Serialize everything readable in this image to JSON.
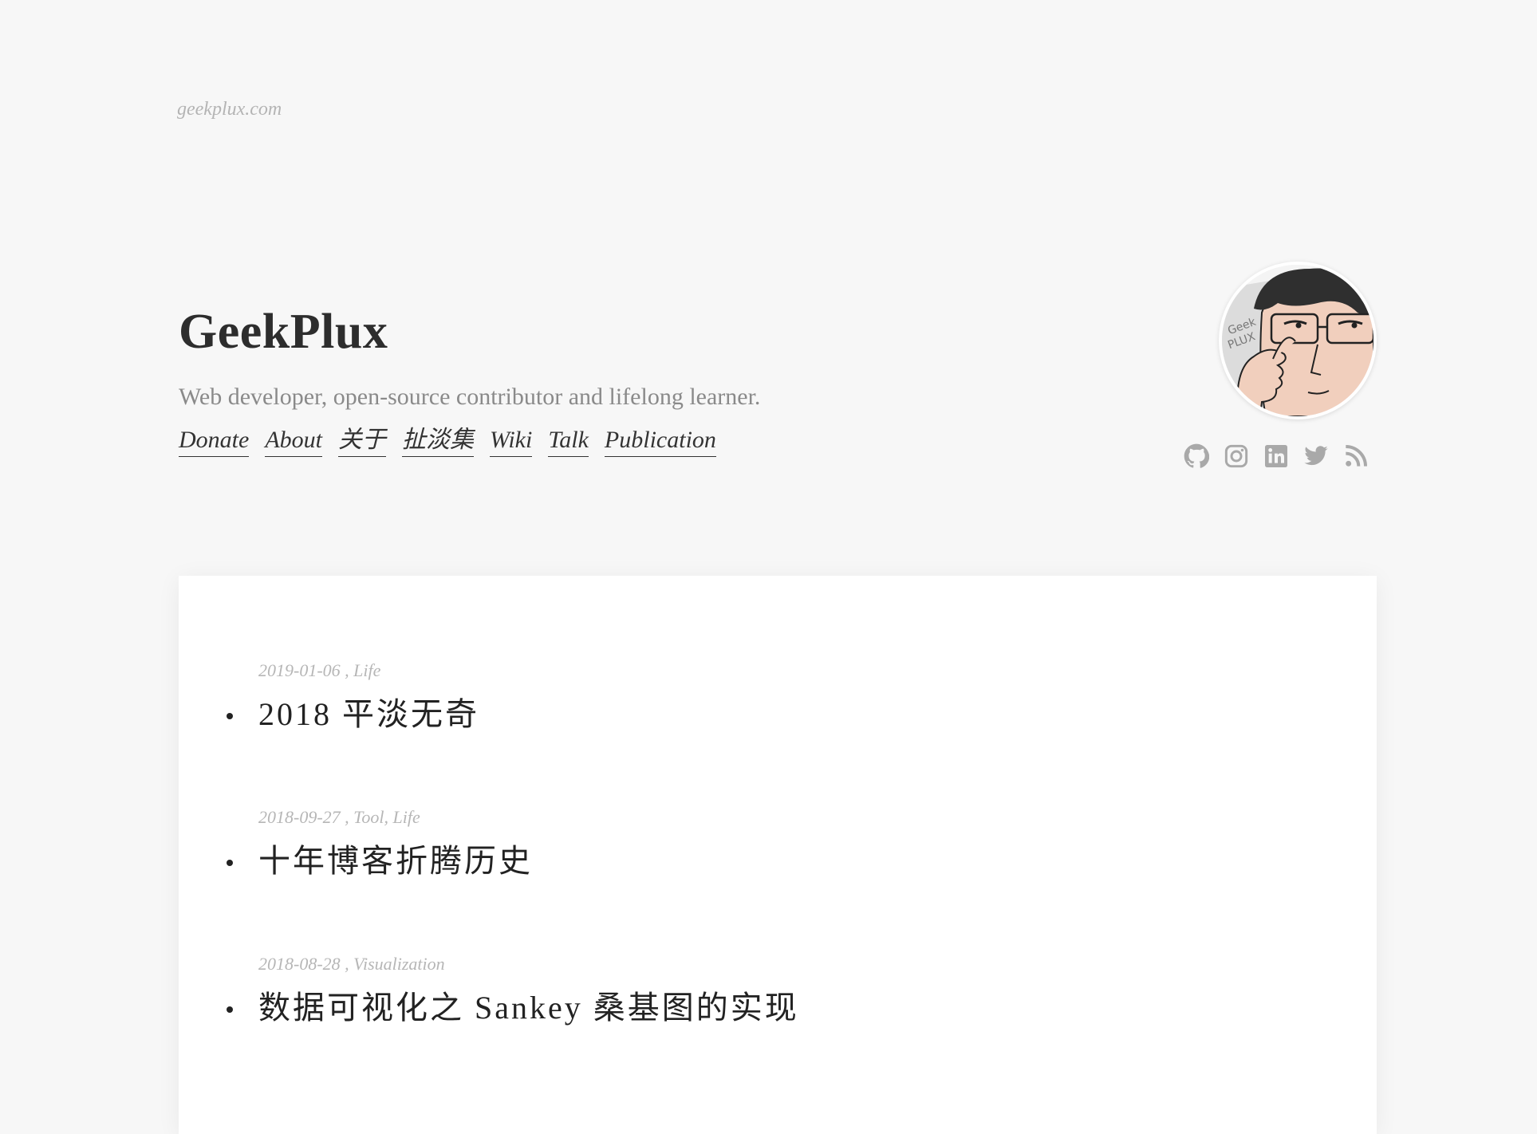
{
  "site": {
    "url": "geekplux.com",
    "title": "GeekPlux",
    "tagline": "Web developer, open-source contributor and lifelong learner."
  },
  "nav": [
    {
      "label": "Donate"
    },
    {
      "label": "About"
    },
    {
      "label": "关于"
    },
    {
      "label": "扯淡集"
    },
    {
      "label": "Wiki"
    },
    {
      "label": "Talk"
    },
    {
      "label": "Publication"
    }
  ],
  "social": [
    {
      "icon": "github-icon"
    },
    {
      "icon": "instagram-icon"
    },
    {
      "icon": "linkedin-icon"
    },
    {
      "icon": "twitter-icon"
    },
    {
      "icon": "rss-icon"
    }
  ],
  "posts": [
    {
      "date": "2019-01-06",
      "categories": "Life",
      "meta": "2019-01-06 , Life",
      "title": "2018 平淡无奇"
    },
    {
      "date": "2018-09-27",
      "categories": "Tool, Life",
      "meta": "2018-09-27 , Tool, Life",
      "title": "十年博客折腾历史"
    },
    {
      "date": "2018-08-28",
      "categories": "Visualization",
      "meta": "2018-08-28 , Visualization",
      "title": "数据可视化之 Sankey 桑基图的实现"
    }
  ],
  "colors": {
    "background": "#f7f7f7",
    "card": "#ffffff",
    "text": "#333333",
    "muted": "#8a8a8a",
    "icon": "#a9a9a9"
  }
}
